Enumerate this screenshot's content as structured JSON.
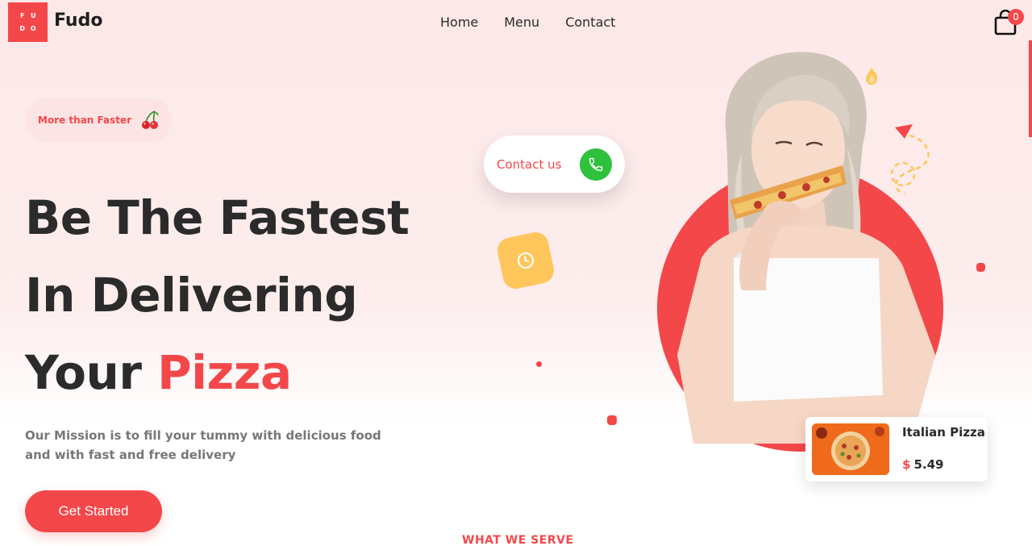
{
  "brand": {
    "logo_letters": [
      "F",
      "U",
      "D",
      "O"
    ],
    "name": "Fudo",
    "accent_color": "#f4474a"
  },
  "nav": {
    "items": [
      {
        "label": "Home"
      },
      {
        "label": "Menu"
      },
      {
        "label": "Contact"
      }
    ],
    "cart_count": "0",
    "cart_icon": "shopping-bag-icon"
  },
  "hero": {
    "badge_text": "More than Faster",
    "badge_icon": "cherry-icon",
    "headline_line1": "Be The Fastest",
    "headline_line2": "In Delivering",
    "headline_line3_plain": "Your",
    "headline_line3_accent": "Pizza",
    "mission": "Our Mission is to fill your tummy with delicious food and with fast and free delivery",
    "cta_label": "Get Started"
  },
  "contact_card": {
    "label": "Contact us",
    "icon": "phone-icon",
    "icon_color": "#2ec13b"
  },
  "food_card": {
    "name": "Italian Pizza",
    "currency": "$",
    "price": "5.49"
  },
  "section": {
    "next_heading": "WHAT WE SERVE"
  }
}
